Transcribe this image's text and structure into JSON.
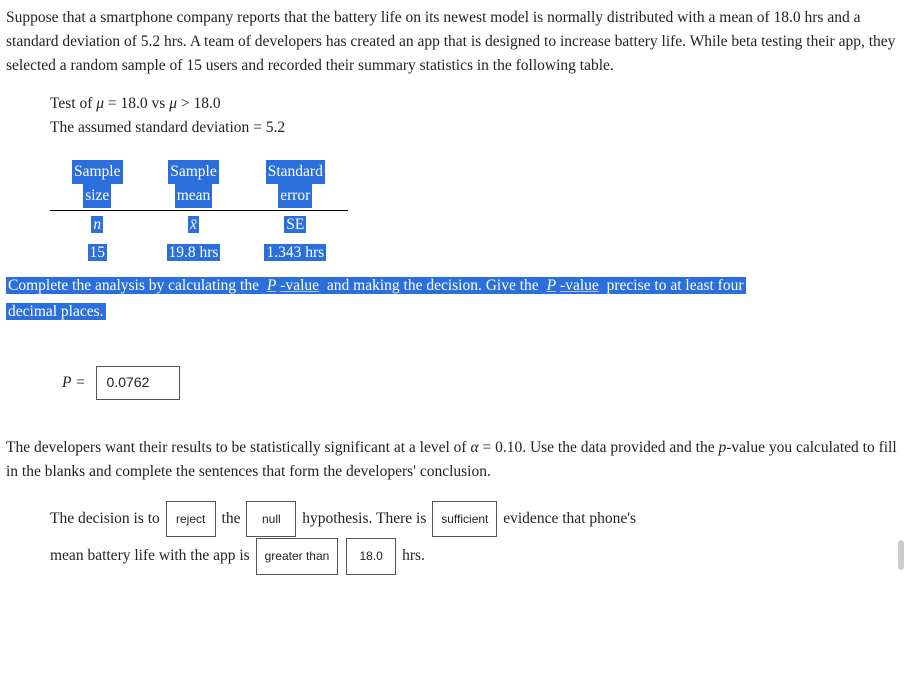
{
  "intro": "Suppose that a smartphone company reports that the battery life on its newest model is normally distributed with a mean of 18.0 hrs and a standard deviation of 5.2 hrs. A team of developers has created an app that is designed to increase battery life. While beta testing their app, they selected a random sample of 15 users and recorded their summary statistics in the following table.",
  "test": {
    "line1_prefix": "Test of ",
    "mu": "μ",
    "eq": " = 18.0 vs ",
    "gt": " > 18.0",
    "line2": "The assumed standard deviation = 5.2"
  },
  "table": {
    "headers": {
      "size1": "Sample",
      "size2": "size",
      "mean1": "Sample",
      "mean2": "mean",
      "se1": "Standard",
      "se2": "error"
    },
    "symbols": {
      "n": "n",
      "xbar": "x̄",
      "se": "SE"
    },
    "values": {
      "n": "15",
      "xbar": "19.8 hrs",
      "se": "1.343 hrs"
    }
  },
  "instruction": {
    "p1": "Complete the analysis by calculating the ",
    "pval1": "P",
    "p1b": "-value",
    "p2": " and making the decision. Give the ",
    "p3": " precise to at least four",
    "p4": "decimal places."
  },
  "p_row": {
    "label": "P =",
    "value": "0.0762"
  },
  "conclusion_intro": {
    "t1": "The developers want their results to be statistically significant at a level of ",
    "alpha": "α",
    "t2": " = 0.10. Use the data provided and the ",
    "pword": "p",
    "t3": "-value you calculated to fill in the blanks and complete the sentences that form the developers' conclusion."
  },
  "fill": {
    "s1": "The decision is to",
    "b1": "reject",
    "s2": "the",
    "b2": "null",
    "s3": "hypothesis. There is",
    "b3": "sufficient",
    "s4": "evidence that phone's",
    "s5": "mean battery life with the app is",
    "b4": "greater than",
    "b5": "18.0",
    "s6": "hrs."
  }
}
